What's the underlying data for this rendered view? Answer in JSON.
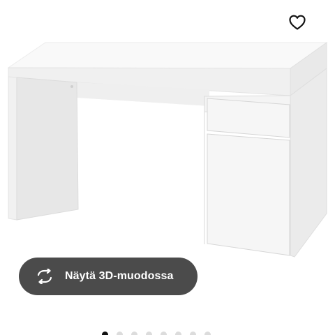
{
  "product": {
    "image_alt": "Valkoinen kirjoituspöytä"
  },
  "favorite": {
    "icon": "heart-outline-icon"
  },
  "view_3d": {
    "label": "Näytä 3D-muodossa",
    "icon": "rotate-3d-icon"
  },
  "pagination": {
    "total": 8,
    "active_index": 0
  },
  "colors": {
    "button_bg": "#4b4b4b",
    "button_text": "#ffffff",
    "dot_active": "#111111",
    "dot_inactive": "#dcdcdc"
  }
}
